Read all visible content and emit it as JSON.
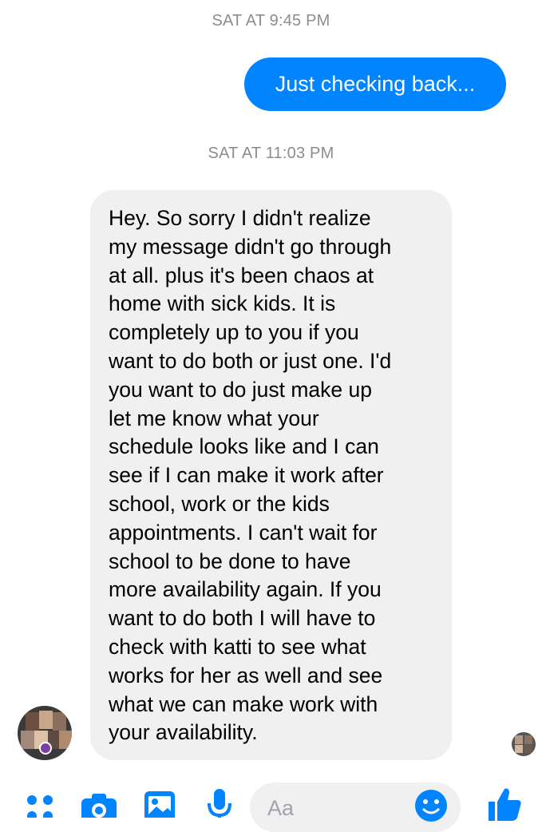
{
  "conversation": {
    "timestamps": [
      "SAT AT 9:45 PM",
      "SAT AT 11:03 PM"
    ],
    "outgoing_message": "Just checking back...",
    "incoming_message": "Hey. So sorry I didn't realize\nmy message didn't go through\nat all. plus it's been chaos at\nhome with sick kids. It is\ncompletely up to you if you\nwant to do both or just one. I'd\nyou want to do just make up\nlet me know what your\nschedule looks like and I can\nsee if I can make it work after\nschool, work or the kids\nappointments.  I can't wait for\nschool to be done to have\nmore availability again.  If you\nwant to do both I will have to\ncheck with katti to see what\nworks for her as well and see\nwhat we can make work with\nyour availability."
  },
  "composer": {
    "placeholder": "Aa",
    "icons": [
      "menu-dots-icon",
      "camera-icon",
      "image-icon",
      "microphone-icon",
      "emoji-icon",
      "thumbs-up-icon"
    ]
  },
  "colors": {
    "accent": "#0084ff",
    "incoming_bubble": "#f0f0f0",
    "timestamp_text": "#8a8d91"
  }
}
